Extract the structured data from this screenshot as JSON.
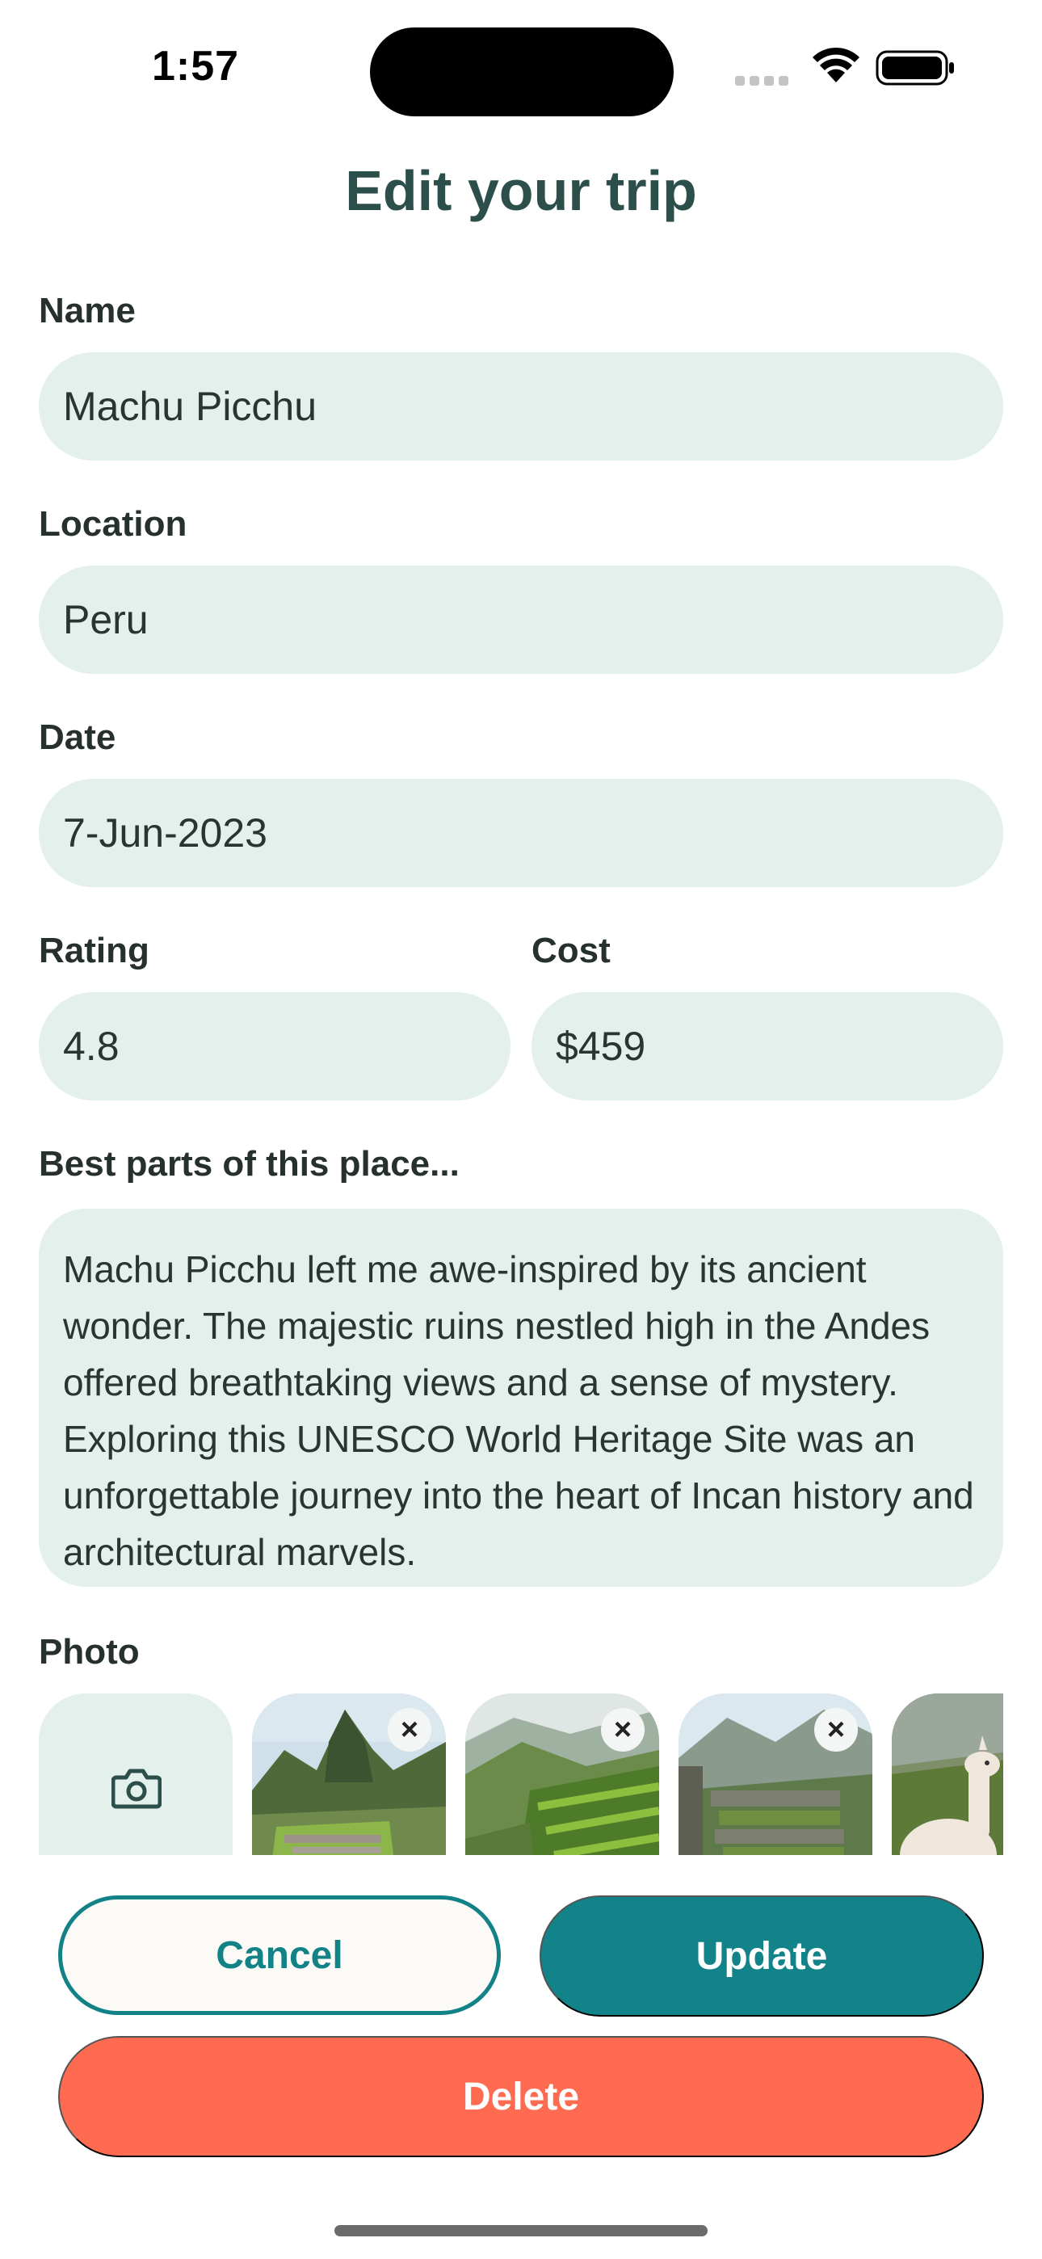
{
  "status_bar": {
    "time": "1:57"
  },
  "header": {
    "title": "Edit your trip"
  },
  "form": {
    "name": {
      "label": "Name",
      "value": "Machu Picchu"
    },
    "location": {
      "label": "Location",
      "value": "Peru"
    },
    "date": {
      "label": "Date",
      "value": "7-Jun-2023"
    },
    "rating": {
      "label": "Rating",
      "value": "4.8"
    },
    "cost": {
      "label": "Cost",
      "value": "$459"
    },
    "best_parts": {
      "label": "Best parts of this place...",
      "value": "Machu Picchu left me awe-inspired by its ancient wonder. The majestic ruins nestled high in the Andes offered breathtaking views and a sense of mystery. Exploring this UNESCO World Heritage Site was an unforgettable journey into the heart of Incan history and architectural marvels."
    },
    "photo": {
      "label": "Photo",
      "add_icon": "camera-icon",
      "remove_icon": "close-icon"
    }
  },
  "actions": {
    "cancel_label": "Cancel",
    "update_label": "Update",
    "delete_label": "Delete"
  },
  "colors": {
    "title": "#2d4f4b",
    "input_bg": "#e3f0ec",
    "primary": "#128389",
    "danger": "#fe6b51"
  }
}
